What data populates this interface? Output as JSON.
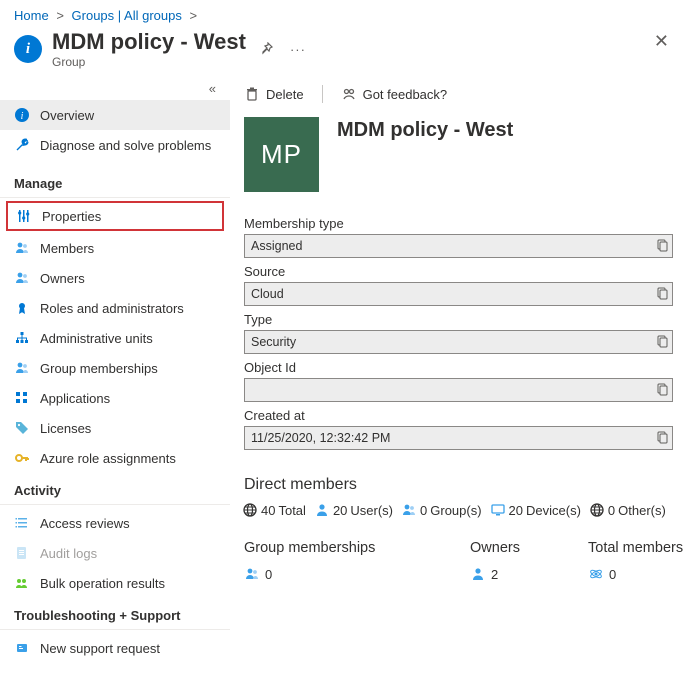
{
  "breadcrumb": {
    "home": "Home",
    "groups": "Groups | All groups"
  },
  "header": {
    "title": "MDM policy - West",
    "subtitle": "Group"
  },
  "sidebar": {
    "overview": "Overview",
    "diagnose": "Diagnose and solve problems",
    "sect_manage": "Manage",
    "properties": "Properties",
    "members": "Members",
    "owners": "Owners",
    "roles": "Roles and administrators",
    "admin_units": "Administrative units",
    "group_memberships": "Group memberships",
    "applications": "Applications",
    "licenses": "Licenses",
    "azure_role": "Azure role assignments",
    "sect_activity": "Activity",
    "access_reviews": "Access reviews",
    "audit_logs": "Audit logs",
    "bulk_results": "Bulk operation results",
    "sect_trouble": "Troubleshooting + Support",
    "new_support": "New support request"
  },
  "cmd": {
    "delete": "Delete",
    "feedback": "Got feedback?"
  },
  "hero": {
    "initials": "MP",
    "title": "MDM policy - West"
  },
  "fields": {
    "membership_label": "Membership type",
    "membership_val": "Assigned",
    "source_label": "Source",
    "source_val": "Cloud",
    "type_label": "Type",
    "type_val": "Security",
    "objectid_label": "Object Id",
    "objectid_val": "",
    "created_label": "Created at",
    "created_val": "11/25/2020, 12:32:42 PM"
  },
  "direct": {
    "title": "Direct members",
    "total_n": "40",
    "total_l": "Total",
    "user_n": "20",
    "user_l": "User(s)",
    "group_n": "0",
    "group_l": "Group(s)",
    "device_n": "20",
    "device_l": "Device(s)",
    "other_n": "0",
    "other_l": "Other(s)"
  },
  "summary": {
    "gm_label": "Group memberships",
    "gm_val": "0",
    "ow_label": "Owners",
    "ow_val": "2",
    "tm_label": "Total members",
    "tm_val": "0"
  }
}
